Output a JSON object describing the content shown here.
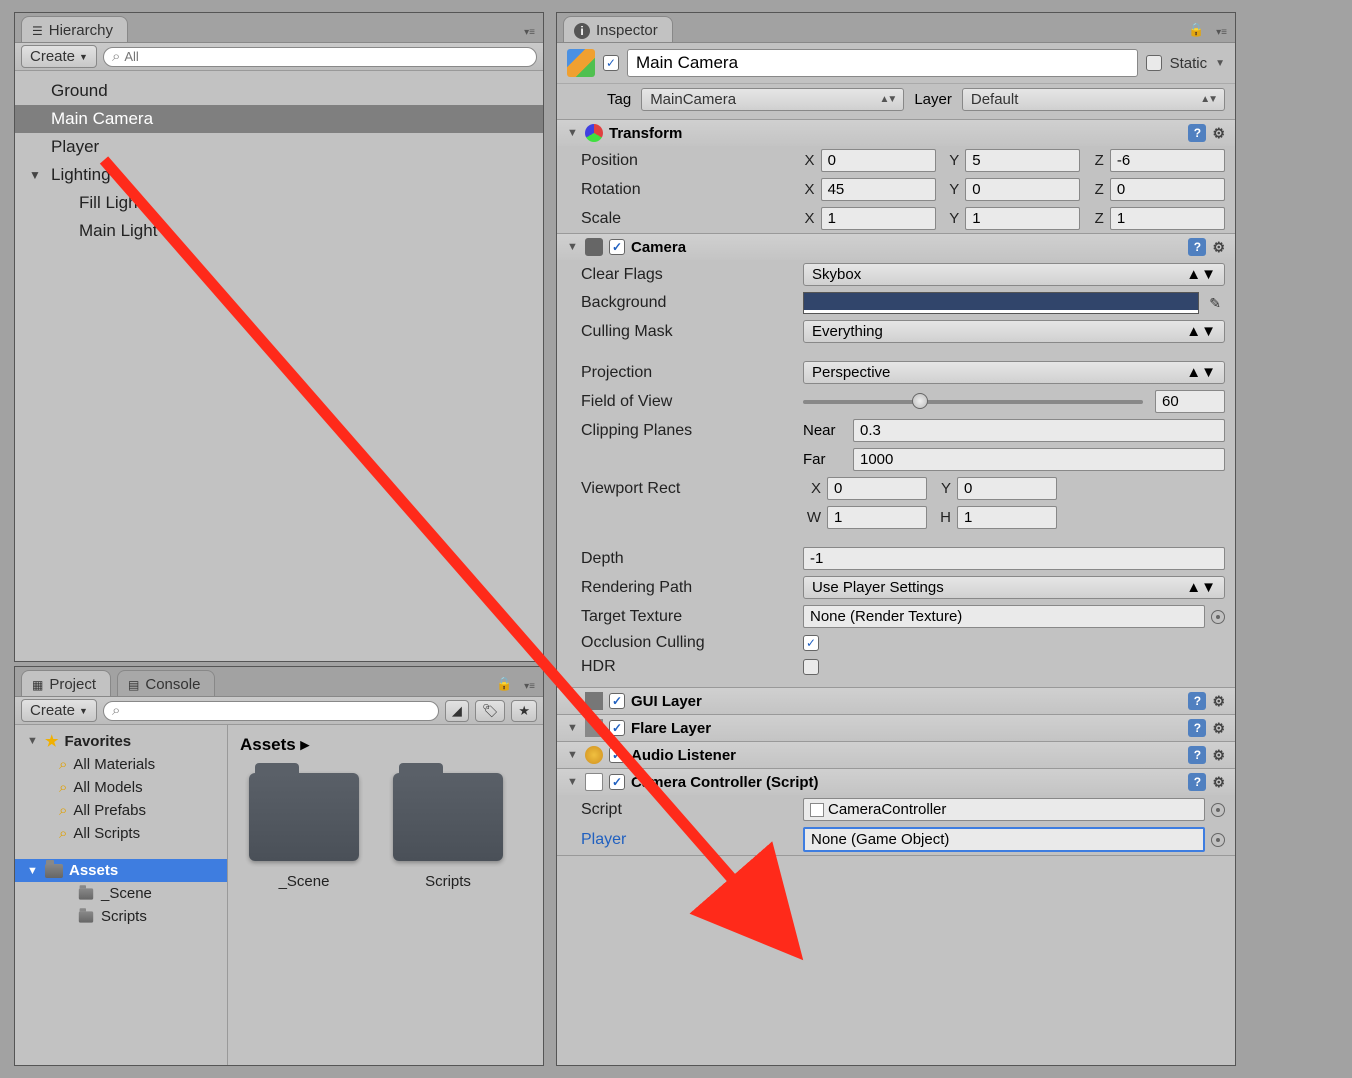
{
  "hierarchy": {
    "tab": "Hierarchy",
    "create": "Create",
    "search_placeholder": "All",
    "items": [
      "Ground",
      "Main Camera",
      "Player",
      "Lighting",
      "Fill Light",
      "Main Light"
    ],
    "selected": "Main Camera"
  },
  "project": {
    "tab": "Project",
    "console_tab": "Console",
    "create": "Create",
    "favorites": "Favorites",
    "fav_items": [
      "All Materials",
      "All Models",
      "All Prefabs",
      "All Scripts"
    ],
    "assets": "Assets",
    "asset_children": [
      "_Scene",
      "Scripts"
    ],
    "breadcrumb": "Assets  ▸",
    "grid": [
      "_Scene",
      "Scripts"
    ]
  },
  "inspector": {
    "tab": "Inspector",
    "name": "Main Camera",
    "static": "Static",
    "tag_label": "Tag",
    "tag_value": "MainCamera",
    "layer_label": "Layer",
    "layer_value": "Default",
    "transform": {
      "title": "Transform",
      "position": {
        "label": "Position",
        "x": "0",
        "y": "5",
        "z": "-6"
      },
      "rotation": {
        "label": "Rotation",
        "x": "45",
        "y": "0",
        "z": "0"
      },
      "scale": {
        "label": "Scale",
        "x": "1",
        "y": "1",
        "z": "1"
      }
    },
    "camera": {
      "title": "Camera",
      "clear_flags": {
        "label": "Clear Flags",
        "value": "Skybox"
      },
      "background": "Background",
      "culling_mask": {
        "label": "Culling Mask",
        "value": "Everything"
      },
      "projection": {
        "label": "Projection",
        "value": "Perspective"
      },
      "fov": {
        "label": "Field of View",
        "value": "60"
      },
      "clipping": {
        "label": "Clipping Planes",
        "near_label": "Near",
        "near": "0.3",
        "far_label": "Far",
        "far": "1000"
      },
      "viewport": {
        "label": "Viewport Rect",
        "x": "0",
        "y": "0",
        "w": "1",
        "h": "1"
      },
      "depth": {
        "label": "Depth",
        "value": "-1"
      },
      "rendering_path": {
        "label": "Rendering Path",
        "value": "Use Player Settings"
      },
      "target_texture": {
        "label": "Target Texture",
        "value": "None (Render Texture)"
      },
      "occlusion": "Occlusion Culling",
      "hdr": "HDR"
    },
    "gui_layer": "GUI Layer",
    "flare_layer": "Flare Layer",
    "audio_listener": "Audio Listener",
    "camera_controller": {
      "title": "Camera Controller (Script)",
      "script_label": "Script",
      "script_value": "CameraController",
      "player_label": "Player",
      "player_value": "None (Game Object)"
    }
  }
}
